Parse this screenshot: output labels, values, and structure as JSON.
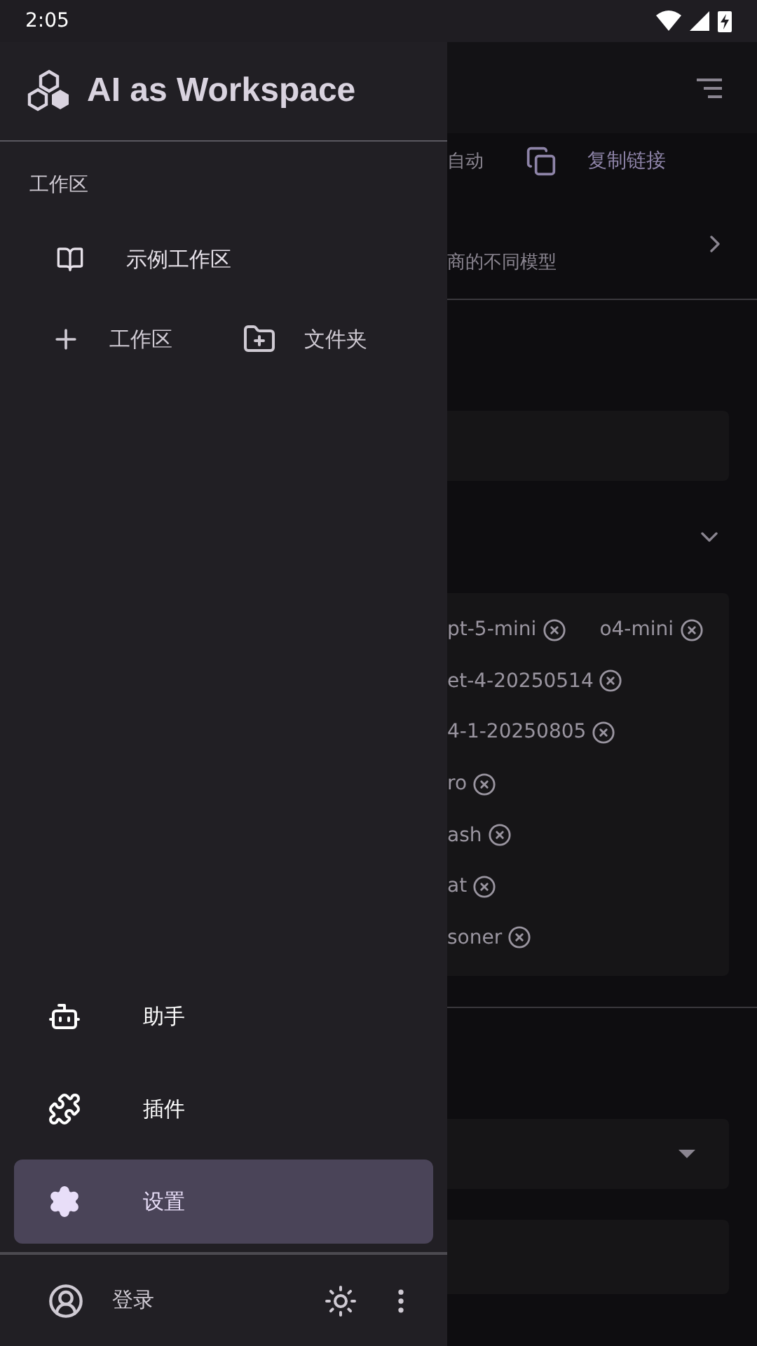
{
  "status_bar": {
    "time": "2:05"
  },
  "drawer": {
    "app_title": "AI as Workspace",
    "section_label": "工作区",
    "workspaces": [
      {
        "label": "示例工作区"
      }
    ],
    "actions": [
      {
        "kind": "add",
        "label": "工作区"
      },
      {
        "kind": "folder",
        "label": "文件夹"
      }
    ],
    "nav": [
      {
        "kind": "assistant",
        "label": "助手",
        "selected": false
      },
      {
        "kind": "plugin",
        "label": "插件",
        "selected": false
      },
      {
        "kind": "settings",
        "label": "设置",
        "selected": true
      }
    ],
    "footer": {
      "login": "登录"
    }
  },
  "background": {
    "row_1_text": "自动",
    "copy_link": "复制链接",
    "row_2_text": "商的不同模型",
    "chip_lines": [
      [
        "pt-5-mini",
        "o4-mini"
      ],
      [
        "et-4-20250514"
      ],
      [
        "4-1-20250805"
      ],
      [
        "ro"
      ],
      [
        "ash"
      ],
      [
        "at"
      ],
      [
        "soner"
      ]
    ]
  }
}
